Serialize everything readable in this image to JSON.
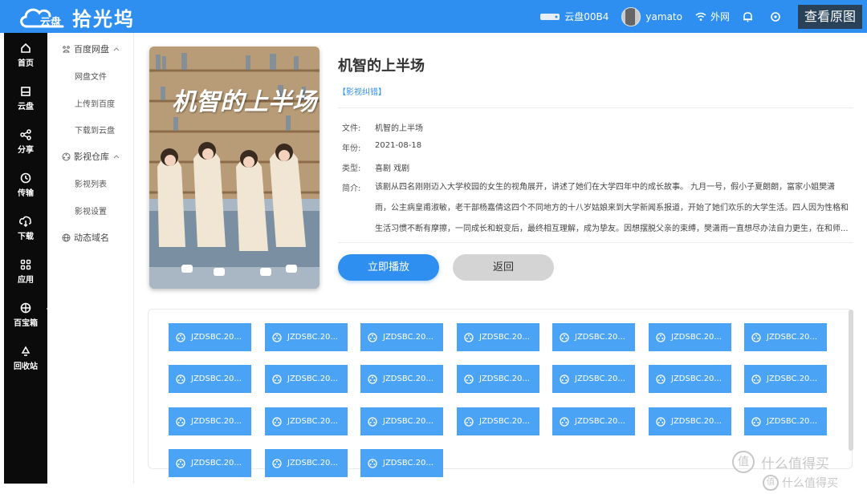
{
  "header": {
    "logo_badge": "云盘",
    "app_name": "拾光坞",
    "device": "云盘00B4",
    "username": "yamato",
    "network": "外网",
    "view_original": "查看原图"
  },
  "leftnav": [
    {
      "label": "首页",
      "icon": "home-icon"
    },
    {
      "label": "云盘",
      "icon": "cloud-disk-icon"
    },
    {
      "label": "分享",
      "icon": "share-icon"
    },
    {
      "label": "传输",
      "icon": "transfer-icon"
    },
    {
      "label": "下载",
      "icon": "download-icon"
    },
    {
      "label": "应用",
      "icon": "apps-icon"
    },
    {
      "label": "百宝箱",
      "icon": "toolbox-icon"
    },
    {
      "label": "回收站",
      "icon": "recycle-icon"
    }
  ],
  "submenu": {
    "baidu": {
      "title": "百度网盘",
      "items": [
        "网盘文件",
        "上传到百度",
        "下载到云盘"
      ]
    },
    "video": {
      "title": "影视仓库",
      "items": [
        "影视列表",
        "影视设置"
      ]
    },
    "ddns": {
      "title": "动态域名"
    }
  },
  "movie": {
    "title": "机智的上半场",
    "poster_title": "机智的上半场",
    "tag": "【影视纠错】",
    "fields": {
      "file_label": "文件:",
      "file": "机智的上半场",
      "year_label": "年份:",
      "year": "2021-08-18",
      "type_label": "类型:",
      "type": "喜剧 戏剧",
      "synopsis_label": "简介:"
    },
    "synopsis_lines": [
      "该剧从四名刚刚迈入大学校园的女生的视角展开，讲述了她们在大学四年中的成长故事。 九月一号，假小子夏朗朗，富家小姐樊潇",
      "雨，公主病皇甫淑敏，老干部杨嘉倩这四个不同地方的十八岁姑娘来到大学新闻系报道，开始了她们欢乐的大学生活。四人因为性格和",
      "生活习惯不断有摩擦，一同成长和蜕变后，最终相互理解，成为挚友。因想摆脱父亲的束缚，樊潇雨一直想尽办法自力更生，在和师..."
    ]
  },
  "actions": {
    "play": "立即播放",
    "back": "返回"
  },
  "files": [
    "JZDSBC.20...",
    "JZDSBC.20...",
    "JZDSBC.20...",
    "JZDSBC.20...",
    "JZDSBC.20...",
    "JZDSBC.20...",
    "JZDSBC.20...",
    "JZDSBC.20...",
    "JZDSBC.20...",
    "JZDSBC.20...",
    "JZDSBC.20...",
    "JZDSBC.20...",
    "JZDSBC.20...",
    "JZDSBC.20...",
    "JZDSBC.20...",
    "JZDSBC.20...",
    "JZDSBC.20...",
    "JZDSBC.20...",
    "JZDSBC.20...",
    "JZDSBC.20...",
    "JZDSBC.20...",
    "JZDSBC.20...",
    "JZDSBC.20...",
    "JZDSBC.20..."
  ],
  "watermark": {
    "logo": "值",
    "text": "什么值得买"
  },
  "colors": {
    "primary": "#2f8ff0",
    "file_button": "#4aa3f5",
    "nav_bg": "#0b0b0b"
  }
}
